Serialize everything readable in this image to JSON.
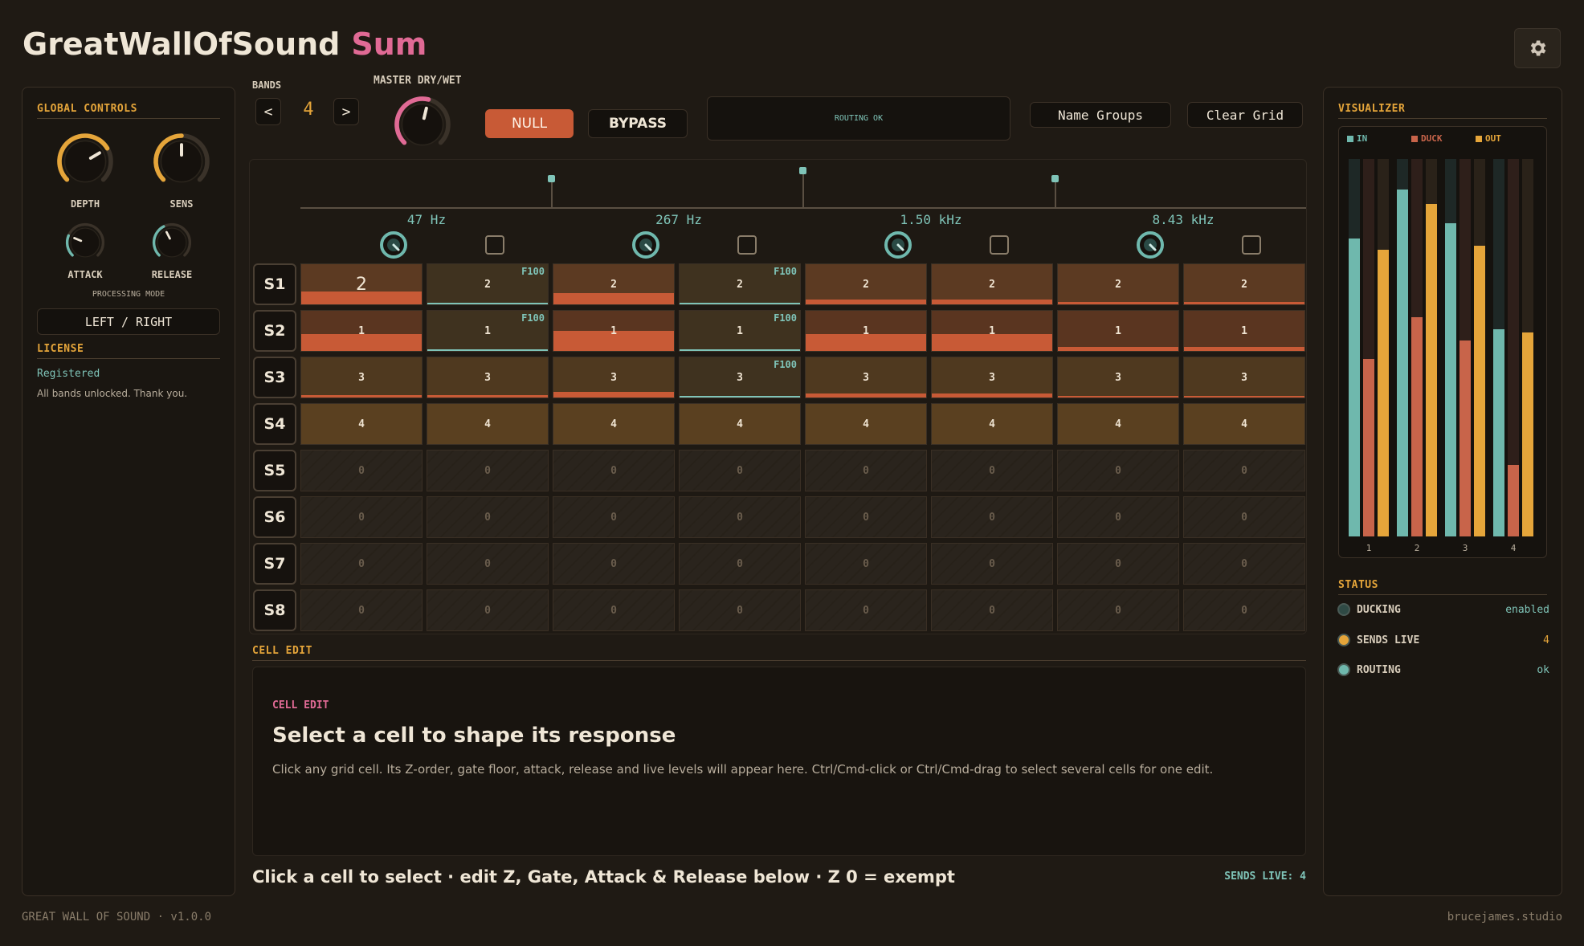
{
  "app": {
    "title": "GreatWallOfSound",
    "variant": "Sum"
  },
  "global_controls": {
    "title": "GLOBAL CONTROLS",
    "knobs": [
      {
        "label": "DEPTH",
        "level": 0.72
      },
      {
        "label": "SENS",
        "level": 0.5
      },
      {
        "label": "ATTACK",
        "level": 0.25
      },
      {
        "label": "RELEASE",
        "level": 0.4
      }
    ],
    "processing_mode_label": "PROCESSING MODE",
    "processing_mode_value": "LEFT / RIGHT"
  },
  "license": {
    "title": "LICENSE",
    "status": "Registered",
    "message": "All bands unlocked. Thank you."
  },
  "toolbar": {
    "bands_label": "BANDS",
    "bands_prev": "<",
    "bands_value": "4",
    "bands_next": ">",
    "master_label": "MASTER DRY/WET",
    "null_label": "NULL",
    "bypass_label": "BYPASS",
    "routing_status": "ROUTING OK",
    "name_groups_label": "Name Groups",
    "clear_grid_label": "Clear Grid"
  },
  "bands": [
    {
      "freq": "47 Hz"
    },
    {
      "freq": "267 Hz"
    },
    {
      "freq": "1.50 kHz"
    },
    {
      "freq": "8.43 kHz"
    }
  ],
  "grid": {
    "rows": [
      {
        "label": "S1",
        "cells": [
          "2",
          "2",
          "2",
          "2",
          "2",
          "2",
          "2",
          "2"
        ]
      },
      {
        "label": "S2",
        "cells": [
          "1",
          "1",
          "1",
          "1",
          "1",
          "1",
          "1",
          "1"
        ]
      },
      {
        "label": "S3",
        "cells": [
          "3",
          "3",
          "3",
          "3",
          "3",
          "3",
          "3",
          "3"
        ]
      },
      {
        "label": "S4",
        "cells": [
          "4",
          "4",
          "4",
          "4",
          "4",
          "4",
          "4",
          "4"
        ]
      },
      {
        "label": "S5",
        "cells": [
          "0",
          "0",
          "0",
          "0",
          "0",
          "0",
          "0",
          "0"
        ]
      },
      {
        "label": "S6",
        "cells": [
          "0",
          "0",
          "0",
          "0",
          "0",
          "0",
          "0",
          "0"
        ]
      },
      {
        "label": "S7",
        "cells": [
          "0",
          "0",
          "0",
          "0",
          "0",
          "0",
          "0",
          "0"
        ]
      },
      {
        "label": "S8",
        "cells": [
          "0",
          "0",
          "0",
          "0",
          "0",
          "0",
          "0",
          "0"
        ]
      }
    ],
    "f100_tag": "F100"
  },
  "cell_edit": {
    "section_title": "CELL EDIT",
    "inner_title": "CELL EDIT",
    "heading": "Select a cell to shape its response",
    "description": "Click any grid cell. Its Z-order, gate floor, attack, release and live levels will appear here. Ctrl/Cmd-click or Ctrl/Cmd-drag to select several cells for one edit."
  },
  "hint": "Click a cell to select · edit Z, Gate, Attack & Release below · Z 0 = exempt",
  "sends_live_footer": "SENDS LIVE: 4",
  "visualizer": {
    "title": "VISUALIZER",
    "legend": [
      {
        "label": "IN",
        "color": "#6fb8ad"
      },
      {
        "label": "DUCK",
        "color": "#c8644a"
      },
      {
        "label": "OUT",
        "color": "#e5a53a"
      }
    ],
    "bands": [
      {
        "label": "1",
        "in": 0.79,
        "duck": 0.47,
        "out": 0.76
      },
      {
        "label": "2",
        "in": 0.92,
        "duck": 0.58,
        "out": 0.88
      },
      {
        "label": "3",
        "in": 0.83,
        "duck": 0.52,
        "out": 0.77
      },
      {
        "label": "4",
        "in": 0.55,
        "duck": 0.19,
        "out": 0.54
      }
    ]
  },
  "status": {
    "title": "STATUS",
    "items": [
      {
        "label": "DUCKING",
        "value": "enabled",
        "dot": "#2f4a45"
      },
      {
        "label": "SENDS LIVE",
        "value": "4",
        "dot": "#e5a53a"
      },
      {
        "label": "ROUTING",
        "value": "ok",
        "dot": "#6fb8ad"
      }
    ]
  },
  "footer": {
    "version": "GREAT WALL OF SOUND · v1.0.0",
    "credit": "brucejames.studio"
  }
}
